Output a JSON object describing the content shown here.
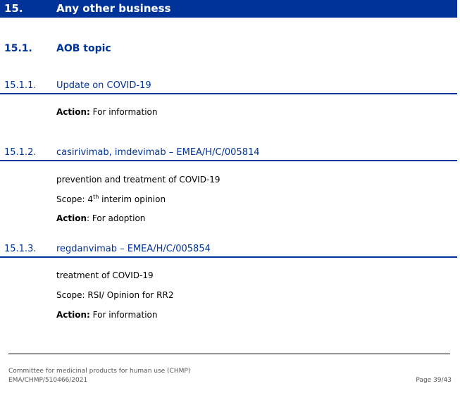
{
  "section": {
    "number": "15.",
    "title": "Any other business"
  },
  "subsection": {
    "number": "15.1.",
    "title": "AOB topic"
  },
  "items": [
    {
      "number": "15.1.1.",
      "title": "Update on COVID-19",
      "action_label": "Action:",
      "action_value": " For information"
    },
    {
      "number": "15.1.2.",
      "title": "casirivimab, imdevimab – EMEA/H/C/005814",
      "line1": "prevention and treatment of COVID-19",
      "scope_prefix": "Scope: 4",
      "scope_sup": "th",
      "scope_suffix": " interim opinion",
      "action_label": "Action",
      "action_value": ": For adoption"
    },
    {
      "number": "15.1.3.",
      "title": "regdanvimab – EMEA/H/C/005854",
      "line1": "treatment of COVID-19",
      "scope": "Scope: RSI/ Opinion for RR2",
      "action_label": "Action:",
      "action_value": " For information"
    }
  ],
  "footer": {
    "committee": "Committee for medicinal products for human use (CHMP)",
    "reference": "EMA/CHMP/510466/2021",
    "page": "Page 39/43"
  }
}
